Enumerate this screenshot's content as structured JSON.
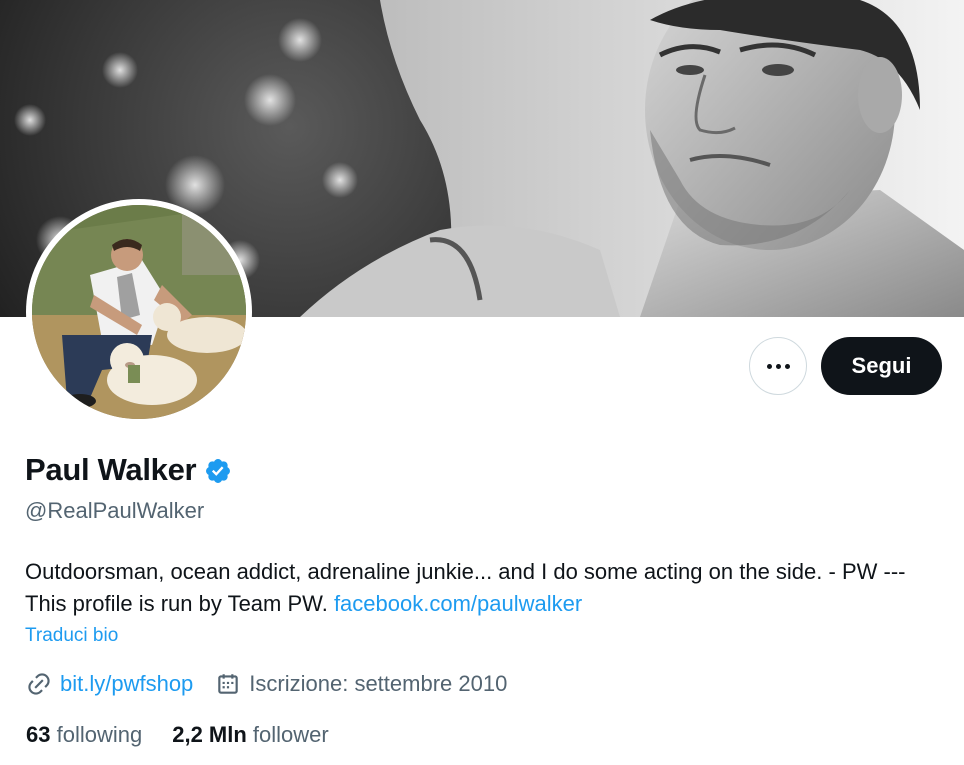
{
  "banner": {
    "icon": "banner-photo"
  },
  "avatar": {
    "icon": "avatar-photo"
  },
  "actions": {
    "more_icon": "ellipsis-icon",
    "follow_label": "Segui"
  },
  "profile": {
    "display_name": "Paul Walker",
    "verified_icon": "verified-badge-icon",
    "handle": "@RealPaulWalker",
    "bio_text": "Outdoorsman, ocean addict, adrenaline junkie... and I do some acting on the side. - PW ---This profile is run by Team PW.",
    "bio_link": "facebook.com/paulwalker",
    "translate_label": "Traduci bio"
  },
  "meta": {
    "website_icon": "link-icon",
    "website": "bit.ly/pwfshop",
    "joined_icon": "calendar-icon",
    "joined": "Iscrizione: settembre 2010"
  },
  "stats": {
    "following_count": "63",
    "following_label": "following",
    "followers_count": "2,2 Mln",
    "followers_label": "follower"
  },
  "colors": {
    "accent": "#1d9bf0",
    "text_primary": "#0f1419",
    "text_secondary": "#536471",
    "button_dark": "#0f1419",
    "border": "#cfd9de"
  }
}
